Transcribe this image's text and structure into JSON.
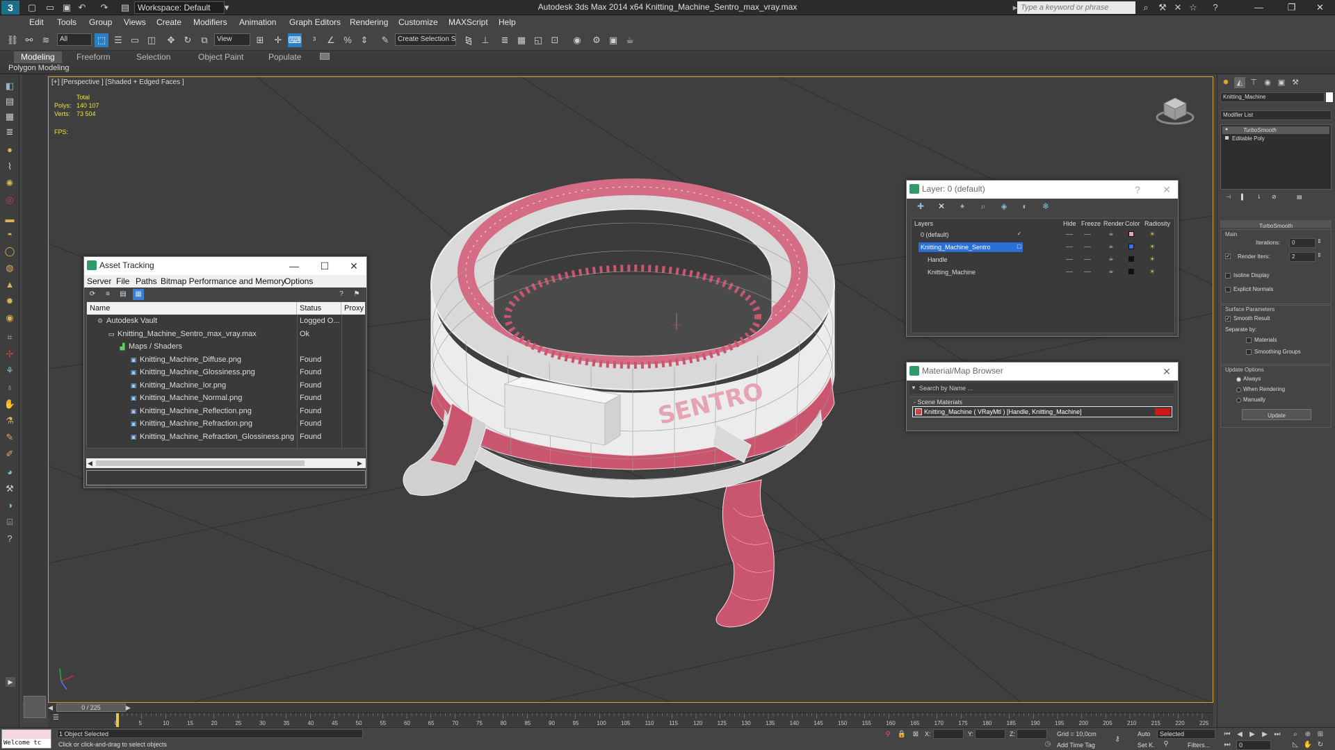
{
  "app": {
    "window_title": "Autodesk 3ds Max  2014 x64      Knitting_Machine_Sentro_max_vray.max",
    "workspace": "Workspace: Default",
    "search_placeholder": "Type a keyword or phrase"
  },
  "menu": [
    "Edit",
    "Tools",
    "Group",
    "Views",
    "Create",
    "Modifiers",
    "Animation",
    "Graph Editors",
    "Rendering",
    "Customize",
    "MAXScript",
    "Help"
  ],
  "toolbar": {
    "filter_select": "All",
    "view_select": "View",
    "selection_set": "Create Selection S"
  },
  "ribbon": {
    "tabs": [
      "Modeling",
      "Freeform",
      "Selection",
      "Object Paint",
      "Populate"
    ],
    "active_tab": "Modeling",
    "subpanel": "Polygon Modeling"
  },
  "viewport": {
    "label": "[+] [Perspective ] [Shaded + Edged Faces ]",
    "stats": {
      "total_label": "Total",
      "polys_label": "Polys:",
      "polys_value": "140 107",
      "verts_label": "Verts:",
      "verts_value": "73 504",
      "fps_label": "FPS:"
    },
    "model_brand_text": "SENTRO"
  },
  "asset_tracking": {
    "title": "Asset Tracking",
    "menu": [
      "Server",
      "File",
      "Paths",
      "Bitmap Performance and Memory",
      "Options"
    ],
    "columns": [
      "Name",
      "Status",
      "Proxy"
    ],
    "rows": [
      {
        "name": "Autodesk Vault",
        "status": "Logged O...",
        "indent": 0,
        "icon": "vault-icon"
      },
      {
        "name": "Knitting_Machine_Sentro_max_vray.max",
        "status": "Ok",
        "indent": 1,
        "icon": "max-file-icon"
      },
      {
        "name": "Maps / Shaders",
        "status": "",
        "indent": 2,
        "icon": "maps-icon"
      },
      {
        "name": "Knitting_Machine_Diffuse.png",
        "status": "Found",
        "indent": 3,
        "icon": "image-file-icon"
      },
      {
        "name": "Knitting_Machine_Glossiness.png",
        "status": "Found",
        "indent": 3,
        "icon": "image-file-icon"
      },
      {
        "name": "Knitting_Machine_Ior.png",
        "status": "Found",
        "indent": 3,
        "icon": "image-file-icon"
      },
      {
        "name": "Knitting_Machine_Normal.png",
        "status": "Found",
        "indent": 3,
        "icon": "image-file-icon"
      },
      {
        "name": "Knitting_Machine_Reflection.png",
        "status": "Found",
        "indent": 3,
        "icon": "image-file-icon"
      },
      {
        "name": "Knitting_Machine_Refraction.png",
        "status": "Found",
        "indent": 3,
        "icon": "image-file-icon"
      },
      {
        "name": "Knitting_Machine_Refraction_Glossiness.png",
        "status": "Found",
        "indent": 3,
        "icon": "image-file-icon"
      }
    ]
  },
  "layer_dialog": {
    "title": "Layer: 0 (default)",
    "columns": [
      "Layers",
      "Hide",
      "Freeze",
      "Render",
      "Color",
      "Radiosity"
    ],
    "rows": [
      {
        "name": "0 (default)",
        "checked": true,
        "selected": false,
        "indent": 0,
        "color": "#e8a0c8"
      },
      {
        "name": "Knitting_Machine_Sentro",
        "checked": false,
        "selected": true,
        "indent": 0,
        "color": "#3a70e0"
      },
      {
        "name": "Handle",
        "checked": false,
        "selected": false,
        "indent": 1,
        "color": "#111111"
      },
      {
        "name": "Knitting_Machine",
        "checked": false,
        "selected": false,
        "indent": 1,
        "color": "#111111"
      }
    ]
  },
  "material_browser": {
    "title": "Material/Map Browser",
    "search_placeholder": "Search by Name ...",
    "section": "- Scene Materials",
    "entry": "Knitting_Machine  ( VRayMtl ) [Handle, Knitting_Machine]"
  },
  "command_panel": {
    "object_name": "Knitting_Machine",
    "modifier_list": "Modifier List",
    "stack": [
      "TurboSmooth",
      "Editable Poly"
    ],
    "turbosmooth": {
      "title": "TurboSmooth",
      "main_label": "Main",
      "iterations_label": "Iterations:",
      "iterations_value": "0",
      "render_iters_label": "Render Iters:",
      "render_iters_value": "2",
      "isoline": "Isoline Display",
      "explicit_normals": "Explicit Normals",
      "surface_params": "Surface Parameters",
      "smooth_result": "Smooth Result",
      "separate_by": "Separate by:",
      "materials": "Materials",
      "smoothing_groups": "Smoothing Groups",
      "update_options": "Update Options",
      "always": "Always",
      "when_rendering": "When Rendering",
      "manually": "Manually",
      "update_button": "Update"
    }
  },
  "timeline": {
    "frame_counter": "0 / 225",
    "ticks": [
      "0",
      "5",
      "10",
      "15",
      "20",
      "25",
      "30",
      "35",
      "40",
      "45",
      "50",
      "55",
      "60",
      "65",
      "70",
      "75",
      "80",
      "85",
      "90",
      "95",
      "100",
      "105",
      "110",
      "115",
      "120",
      "125",
      "130",
      "135",
      "140",
      "145",
      "150",
      "155",
      "160",
      "165",
      "170",
      "175",
      "180",
      "185",
      "190",
      "195",
      "200",
      "205",
      "210",
      "215",
      "220",
      "225"
    ]
  },
  "statusbar": {
    "listener": "Welcome tc",
    "objects_selected": "1 Object Selected",
    "prompt": "Click or click-and-drag to select objects",
    "x_label": "X:",
    "y_label": "Y:",
    "z_label": "Z:",
    "grid": "Grid = 10,0cm",
    "add_time_tag": "Add Time Tag",
    "auto": "Auto",
    "selected_select": "Selected",
    "set_key": "Set K.",
    "filters": "Filters...",
    "frame_field": "0"
  }
}
